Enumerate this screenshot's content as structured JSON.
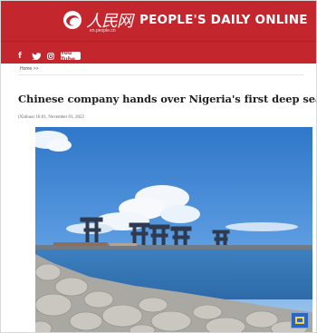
{
  "header": {
    "logo_cn": "人民网",
    "logo_url": "en.people.cn",
    "brand": "PEOPLE'S DAILY ONLINE",
    "bg_color": "#c4262e"
  },
  "social": {
    "facebook": "f",
    "twitter": "🐦",
    "instagram": "instagram-icon",
    "youtube": "You Tube"
  },
  "breadcrumb": "Home >>",
  "article": {
    "title": "Chinese company hands over Nigeria's first deep sea port",
    "dateline": "(Xinhua) 16:01, November 01, 2022"
  },
  "photo": {
    "subject": "port-cranes-photo",
    "badge_icon": "xinhua-logo-icon"
  }
}
